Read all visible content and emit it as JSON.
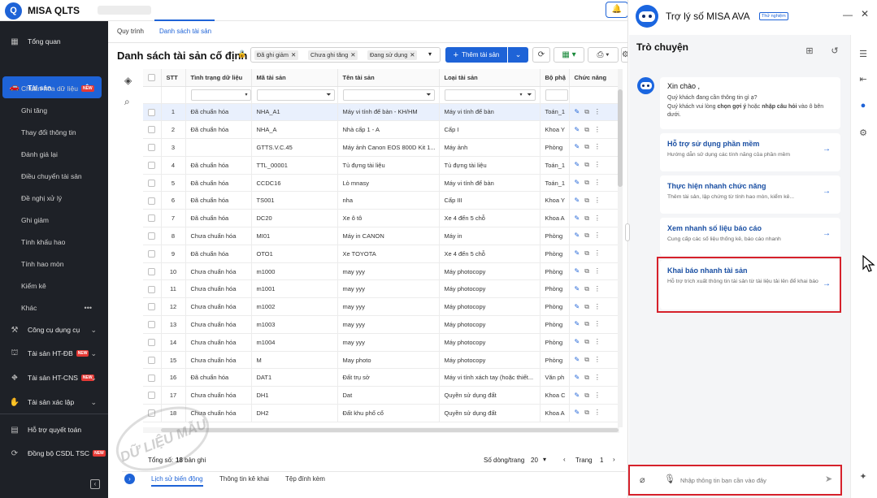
{
  "app": {
    "name": "MISA QLTS",
    "logo_letter": "Q"
  },
  "sidebar": {
    "items": [
      {
        "label": "Tổng quan",
        "icon": "chart-icon"
      },
      {
        "label": "Tài sản",
        "icon": "car-icon",
        "active": true
      },
      {
        "label": "Công cụ dụng cụ",
        "icon": "tools-icon"
      },
      {
        "label": "Tài sản HT-ĐB",
        "icon": "building-icon",
        "badge": "NEW"
      },
      {
        "label": "Tài sản HT-CNS",
        "icon": "road-icon",
        "badge": "NEW"
      },
      {
        "label": "Tài sản xác lập",
        "icon": "hand-icon"
      },
      {
        "label": "Hỗ trợ quyết toán",
        "icon": "calc-icon"
      },
      {
        "label": "Đồng bộ CSDL TSC",
        "icon": "sync-icon",
        "badge": "NEW"
      }
    ],
    "subitems": [
      {
        "label": "Chuẩn hóa dữ liệu",
        "badge": "NEW"
      },
      {
        "label": "Ghi tăng"
      },
      {
        "label": "Thay đổi thông tin"
      },
      {
        "label": "Đánh giá lại"
      },
      {
        "label": "Điều chuyển tài sản"
      },
      {
        "label": "Đề nghị xử lý"
      },
      {
        "label": "Ghi giảm"
      },
      {
        "label": "Tính khấu hao"
      },
      {
        "label": "Tính hao mòn"
      },
      {
        "label": "Kiểm kê"
      },
      {
        "label": "Khác"
      }
    ]
  },
  "tabs": {
    "t1": "Quy trình",
    "t2": "Danh sách tài sản"
  },
  "page": {
    "title": "Danh sách tài sản cố định",
    "filters": [
      "Đã ghi giảm",
      "Chưa ghi tăng",
      "Đang sử dụng"
    ],
    "add_button": "Thêm tài sản"
  },
  "table": {
    "headers": {
      "stt": "STT",
      "status": "Tình trạng dữ liệu",
      "code": "Mã tài sản",
      "name": "Tên tài sản",
      "type": "Loại tài sản",
      "dept": "Bộ phậ",
      "actions": "Chức năng"
    },
    "rows": [
      {
        "stt": "1",
        "status": "Đã chuẩn hóa",
        "code": "NHA_A1",
        "name": "Máy vi tính để bàn - KH/HM",
        "type": "Máy vi tính để bàn",
        "dept": "Toán_1"
      },
      {
        "stt": "2",
        "status": "Đã chuẩn hóa",
        "code": "NHA_A",
        "name": "Nhà cấp 1 - A",
        "type": "Cấp I",
        "dept": "Khoa Y"
      },
      {
        "stt": "3",
        "status": "",
        "code": "GTTS.V.C.45",
        "name": "Máy ảnh Canon EOS 800D Kit 1...",
        "type": "Máy ảnh",
        "dept": "Phòng"
      },
      {
        "stt": "4",
        "status": "Đã chuẩn hóa",
        "code": "TTL_00001",
        "name": "Tủ đựng tài liệu",
        "type": "Tủ đựng tài liệu",
        "dept": "Toán_1"
      },
      {
        "stt": "5",
        "status": "Đã chuẩn hóa",
        "code": "CCDC16",
        "name": "Lò mnasy",
        "type": "Máy vi tính để bàn",
        "dept": "Toán_1"
      },
      {
        "stt": "6",
        "status": "Đã chuẩn hóa",
        "code": "TS001",
        "name": "nha",
        "type": "Cấp III",
        "dept": "Khoa Y"
      },
      {
        "stt": "7",
        "status": "Đã chuẩn hóa",
        "code": "DC20",
        "name": "Xe ô tô",
        "type": "Xe 4 đến 5 chỗ",
        "dept": "Khoa A"
      },
      {
        "stt": "8",
        "status": "Chưa chuẩn hóa",
        "code": "MI01",
        "name": "Máy in CANON",
        "type": "Máy in",
        "dept": "Phòng"
      },
      {
        "stt": "9",
        "status": "Đã chuẩn hóa",
        "code": "OTO1",
        "name": "Xe TOYOTA",
        "type": "Xe 4 đến 5 chỗ",
        "dept": "Phòng"
      },
      {
        "stt": "10",
        "status": "Chưa chuẩn hóa",
        "code": "m1000",
        "name": "may yyy",
        "type": "Máy photocopy",
        "dept": "Phòng"
      },
      {
        "stt": "11",
        "status": "Chưa chuẩn hóa",
        "code": "m1001",
        "name": "may yyy",
        "type": "Máy photocopy",
        "dept": "Phòng"
      },
      {
        "stt": "12",
        "status": "Chưa chuẩn hóa",
        "code": "m1002",
        "name": "may yyy",
        "type": "Máy photocopy",
        "dept": "Phòng"
      },
      {
        "stt": "13",
        "status": "Chưa chuẩn hóa",
        "code": "m1003",
        "name": "may yyy",
        "type": "Máy photocopy",
        "dept": "Phòng"
      },
      {
        "stt": "14",
        "status": "Chưa chuẩn hóa",
        "code": "m1004",
        "name": "may yyy",
        "type": "Máy photocopy",
        "dept": "Phòng"
      },
      {
        "stt": "15",
        "status": "Chưa chuẩn hóa",
        "code": "M",
        "name": "May photo",
        "type": "Máy photocopy",
        "dept": "Phòng"
      },
      {
        "stt": "16",
        "status": "Đã chuẩn hóa",
        "code": "DAT1",
        "name": "Đất trụ sở",
        "type": "Máy vi tính xách tay (hoặc thiết...",
        "dept": "Văn ph"
      },
      {
        "stt": "17",
        "status": "Chưa chuẩn hóa",
        "code": "DH1",
        "name": "Dat",
        "type": "Quyền sử dụng đất",
        "dept": "Khoa C"
      },
      {
        "stt": "18",
        "status": "Chưa chuẩn hóa",
        "code": "DH2",
        "name": "Đất khu phố cổ",
        "type": "Quyền sử dụng đất",
        "dept": "Khoa A"
      }
    ]
  },
  "footer": {
    "total_label": "Tổng số:",
    "total_value": "18",
    "total_suffix": "bản ghi",
    "page_size_label": "Số dòng/trang",
    "page_size": "20",
    "page_label": "Trang",
    "page": "1",
    "bottom_tabs": [
      "Lịch sử biến động",
      "Thông tin kê khai",
      "Tệp đính kèm"
    ]
  },
  "watermark": "DỮ LIỆU MẪU",
  "assistant": {
    "title": "Trợ lý số MISA AVA",
    "beta": "Thử nghiệm",
    "chat_title": "Trò chuyện",
    "greeting": "Xin chào ,",
    "greeting_line1": "Quý khách đang cần thông tin gì ạ?",
    "greeting_line2_pre": "Quý khách vui lòng ",
    "greeting_bold1": "chọn gợi ý",
    "greeting_mid": " hoặc ",
    "greeting_bold2": "nhập câu hỏi",
    "greeting_post": " vào ô bên dưới.",
    "options": [
      {
        "title": "Hỗ trợ sử dụng phần mềm",
        "desc": "Hướng dẫn sử dụng các tính năng của phần mềm"
      },
      {
        "title": "Thực hiện nhanh chức năng",
        "desc": "Thêm tài sản, lập chứng từ tính hao mòn, kiểm kê..."
      },
      {
        "title": "Xem nhanh số liệu báo cáo",
        "desc": "Cung cấp các số liệu thống kê, báo cáo nhanh"
      },
      {
        "title": "Khai báo nhanh tài sản",
        "desc": "Hỗ trợ trích xuất thông tin tài sản từ tài liệu tải lên để khai báo"
      }
    ],
    "input_placeholder": "Nhập thông tin bạn cần vào đây"
  },
  "colors": {
    "accent": "#1e63d7",
    "sidebar": "#1e2127",
    "highlight": "#d6212b"
  }
}
